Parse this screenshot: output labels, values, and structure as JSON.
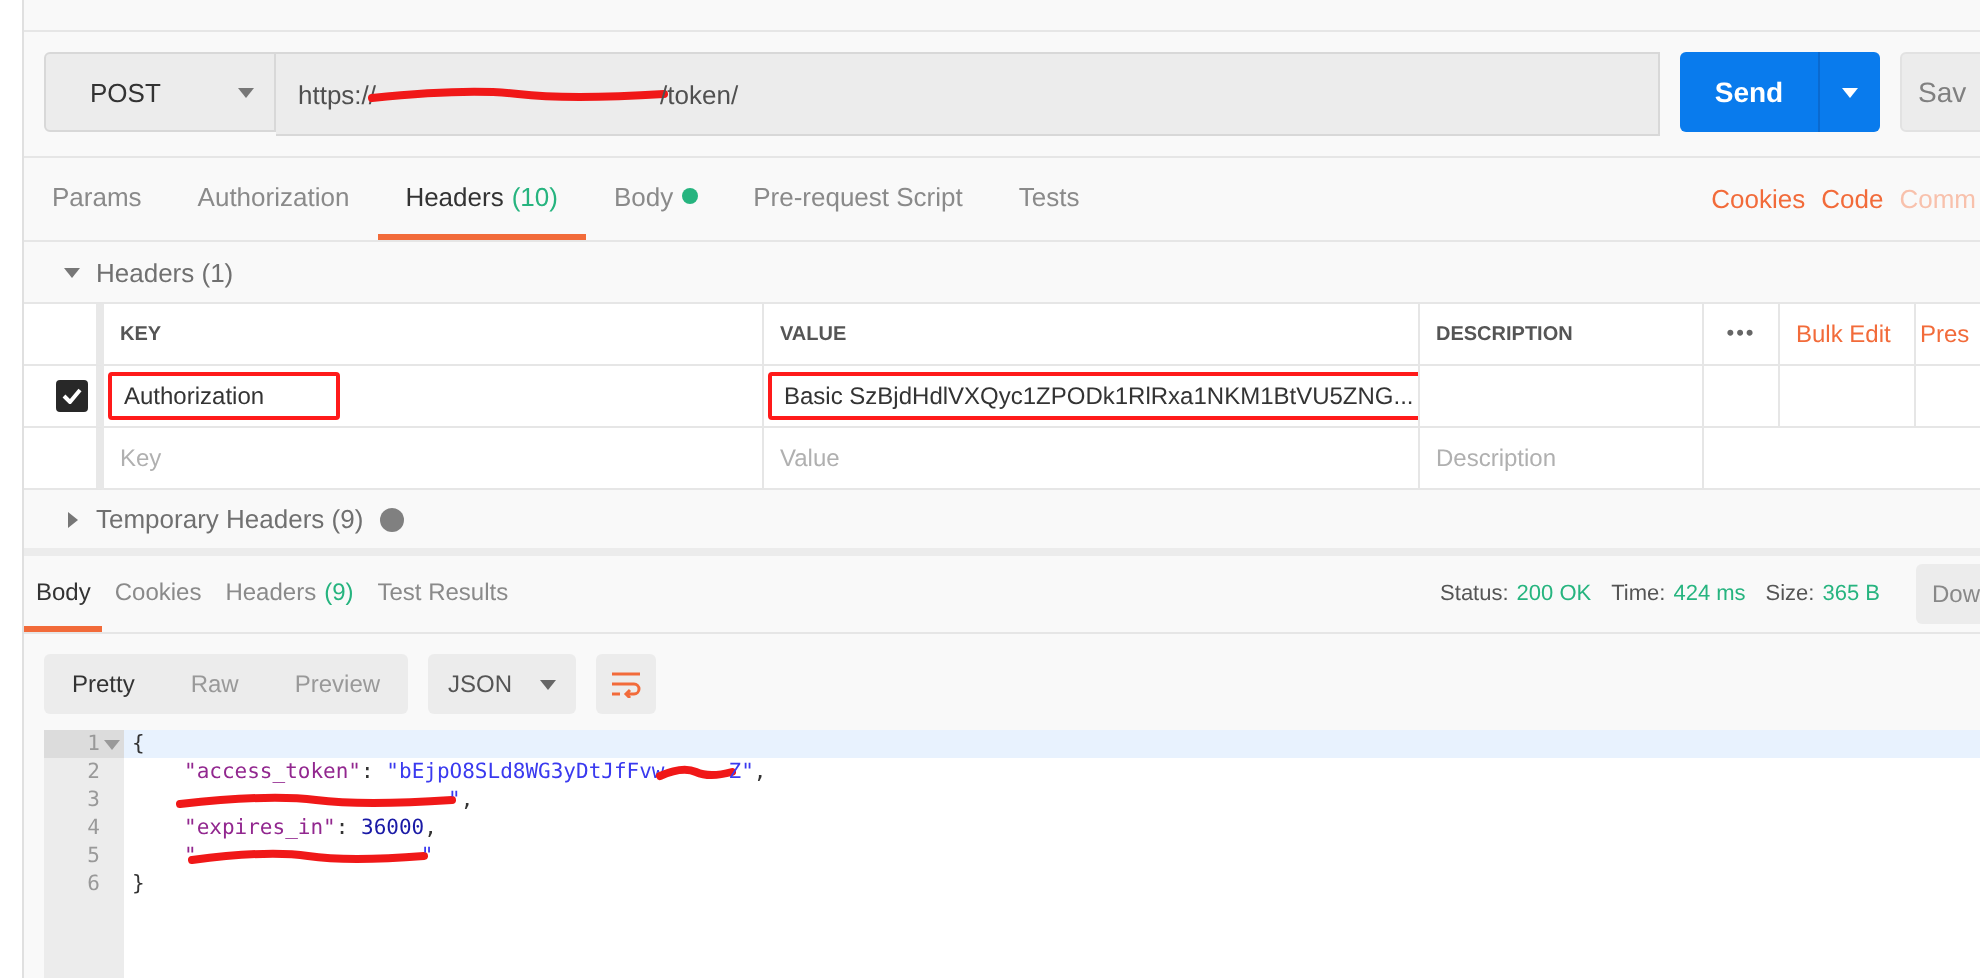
{
  "request": {
    "method": "POST",
    "url": [
      {
        "kind": "text",
        "text": "https://"
      },
      {
        "kind": "redaction"
      },
      {
        "kind": "text",
        "text": "/token/"
      }
    ],
    "send": "Send",
    "save": "Sav"
  },
  "request_tabs": [
    {
      "label": "Params",
      "dot": false,
      "selected": false
    },
    {
      "label": "Authorization",
      "dot": false,
      "selected": false
    },
    {
      "label": "Headers",
      "count": "(10)",
      "dot": false,
      "selected": true
    },
    {
      "label": "Body",
      "dot": true,
      "selected": false
    },
    {
      "label": "Pre-request Script",
      "dot": false,
      "selected": false
    },
    {
      "label": "Tests",
      "dot": false,
      "selected": false
    }
  ],
  "request_links": [
    {
      "label": "Cookies",
      "faded": false
    },
    {
      "label": "Code",
      "faded": false
    },
    {
      "label": "Comm",
      "faded": true
    }
  ],
  "headers_section": {
    "title": "Headers (1)",
    "expanded": true,
    "columns": [
      "KEY",
      "VALUE",
      "DESCRIPTION"
    ],
    "more": "•••",
    "actions": [
      "Bulk Edit",
      "Pres"
    ],
    "rows": [
      {
        "checked": true,
        "key": "Authorization",
        "value": "Basic SzBjdHdlVXQyc1ZPODk1RlRxa1NKM1BtVU5ZNG...",
        "highlighted": true
      }
    ],
    "placeholder": {
      "key": "Key",
      "value": "Value",
      "description": "Description"
    }
  },
  "temporary_headers": {
    "title": "Temporary Headers (9)",
    "expanded": false
  },
  "response": {
    "tabs": [
      {
        "label": "Body",
        "selected": true
      },
      {
        "label": "Cookies",
        "selected": false
      },
      {
        "label": "Headers",
        "count": "(9)",
        "selected": false
      },
      {
        "label": "Test Results",
        "selected": false
      }
    ],
    "status_label": "Status:",
    "status": "200 OK",
    "time_label": "Time:",
    "time": "424 ms",
    "size_label": "Size:",
    "size": "365 B",
    "download": "Dow",
    "views": [
      {
        "label": "Pretty",
        "selected": true
      },
      {
        "label": "Raw",
        "selected": false
      },
      {
        "label": "Preview",
        "selected": false
      }
    ],
    "format": "JSON"
  },
  "code_lines": [
    {
      "number": "1",
      "fold": true,
      "active": true,
      "segments": [
        {
          "kind": "punct",
          "text": "{"
        }
      ]
    },
    {
      "number": "2",
      "fold": false,
      "active": false,
      "segments": [
        {
          "kind": "key",
          "text": "\"access_token\""
        },
        {
          "kind": "punct",
          "text": ": "
        },
        {
          "kind": "string",
          "text": "\"bEjpO8SLd8WG3yDtJfFvw"
        },
        {
          "kind": "redaction"
        },
        {
          "kind": "string",
          "text": "Z\""
        },
        {
          "kind": "punct",
          "text": ","
        }
      ]
    },
    {
      "number": "3",
      "fold": false,
      "active": false,
      "segments": [
        {
          "kind": "redaction"
        },
        {
          "kind": "string",
          "text": "\""
        },
        {
          "kind": "punct",
          "text": ","
        }
      ]
    },
    {
      "number": "4",
      "fold": false,
      "active": false,
      "segments": [
        {
          "kind": "key",
          "text": "\"expires_in\""
        },
        {
          "kind": "punct",
          "text": ": "
        },
        {
          "kind": "number",
          "text": "36000"
        },
        {
          "kind": "punct",
          "text": ","
        }
      ]
    },
    {
      "number": "5",
      "fold": false,
      "active": false,
      "segments": [
        {
          "kind": "key",
          "text": "\""
        },
        {
          "kind": "redaction"
        },
        {
          "kind": "string",
          "text": "\""
        }
      ]
    },
    {
      "number": "6",
      "fold": false,
      "active": false,
      "segments": [
        {
          "kind": "punct",
          "text": "}"
        }
      ]
    }
  ]
}
